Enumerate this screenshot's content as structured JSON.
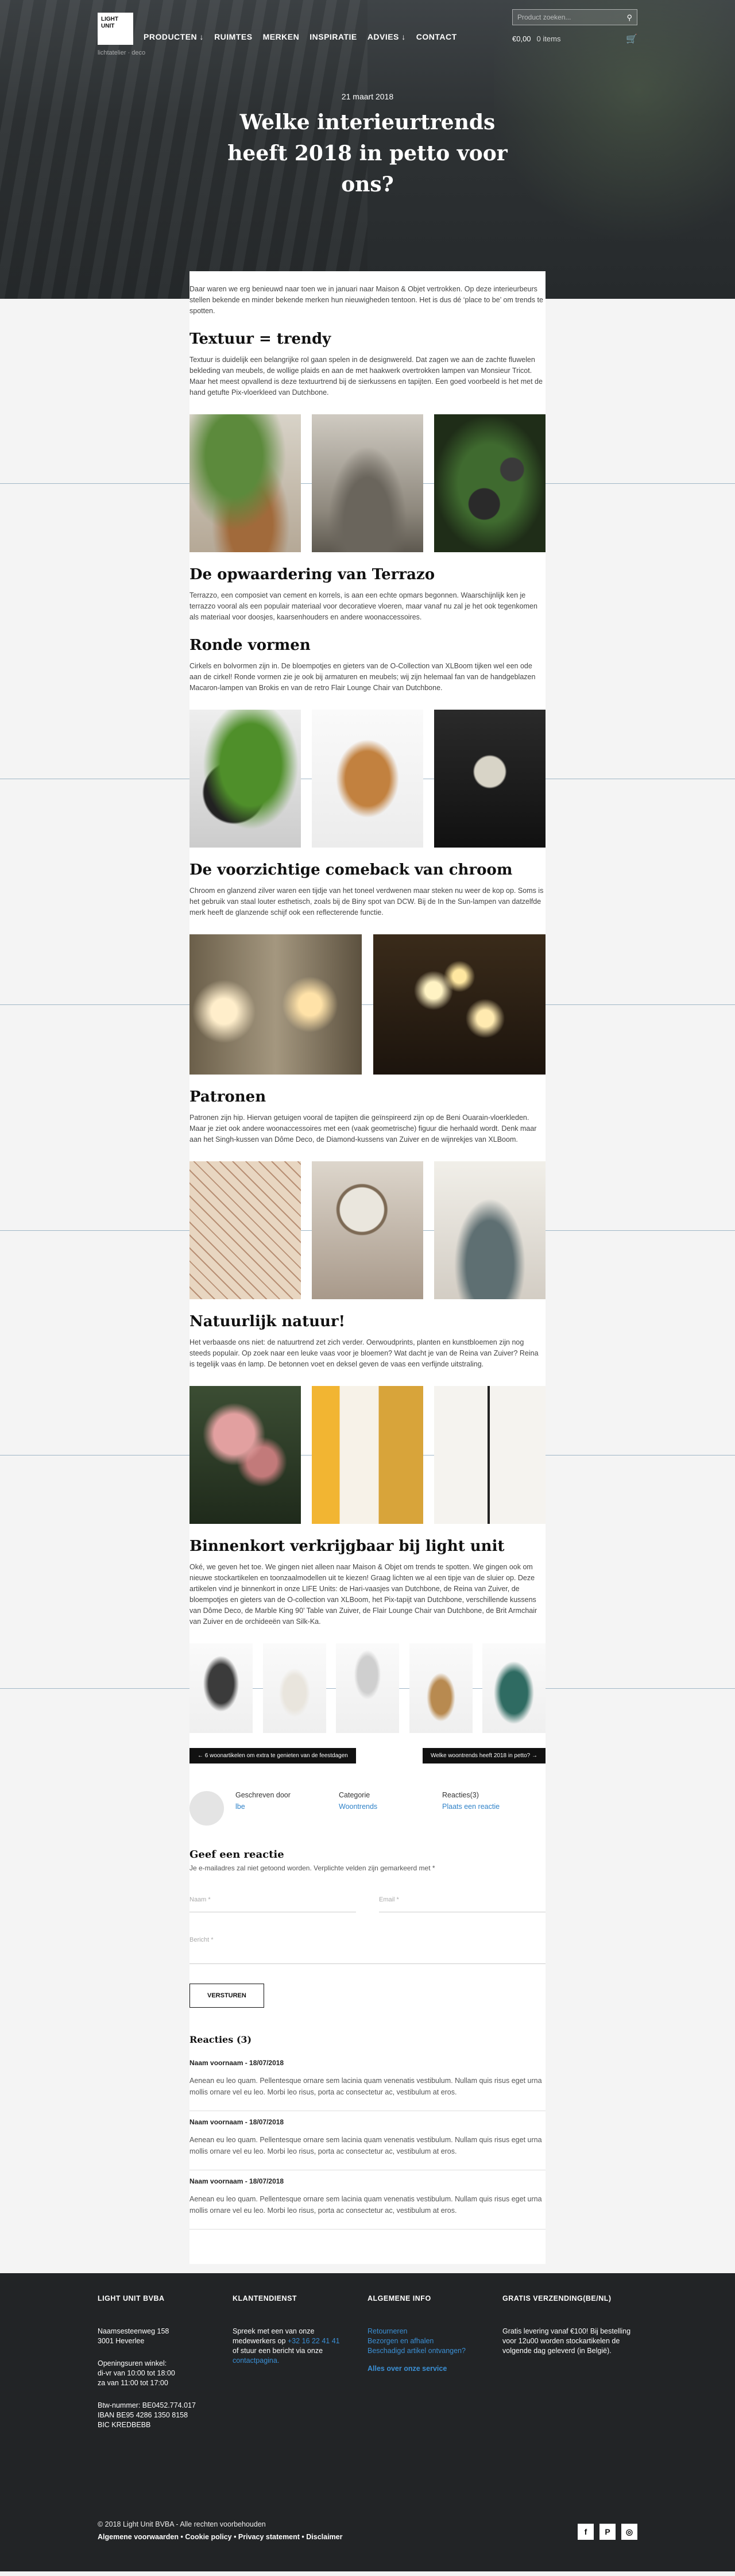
{
  "header": {
    "logo_line1": "LIGHT",
    "logo_line2": "UNIT",
    "nav": [
      "PRODUCTEN ↓",
      "RUIMTES",
      "MERKEN",
      "INSPIRATIE",
      "ADVIES ↓",
      "CONTACT"
    ],
    "sub_logos": "lichtatelier  ·  deco",
    "search_placeholder": "Product zoeken...",
    "cart_total": "€0,00",
    "cart_items": "0 items"
  },
  "hero": {
    "date": "21 maart 2018",
    "title": "Welke interieurtrends heeft 2018 in petto voor ons?"
  },
  "article": {
    "intro": "Daar waren we erg benieuwd naar toen we in januari naar Maison & Objet vertrokken. Op deze interieurbeurs stellen bekende en minder bekende merken hun nieuwigheden tentoon. Het is dus dé ‘place to be’ om trends te spotten.",
    "sections": [
      {
        "title": "Textuur = trendy",
        "text": "Textuur is duidelijk een belangrijke rol gaan spelen in de designwereld. Dat zagen we aan de zachte fluwelen bekleding van meubels, de wollige plaids en aan de met haakwerk overtrokken lampen van Monsieur Tricot.",
        "text2": "Maar het meest opvallend is deze textuurtrend bij de sierkussens en tapijten. Een goed voorbeeld is het met de hand getufte Pix-vloerkleed van Dutchbone."
      },
      {
        "title": "De opwaardering van Terrazo",
        "text": "Terrazzo, een composiet van cement en korrels, is aan een echte opmars begonnen. Waarschijnlijk ken je terrazzo vooral als een populair materiaal voor decoratieve vloeren, maar vanaf nu zal je het ook tegenkomen als materiaal voor doosjes, kaarsenhouders en andere woonaccessoires."
      },
      {
        "title": "Ronde vormen",
        "text": "Cirkels en bolvormen zijn in. De bloempotjes en gieters van de O-Collection van XLBoom tijken wel een ode aan de cirkel! Ronde vormen zie je ook bij armaturen en meubels; wij zijn helemaal fan van de handgeblazen Macaron-lampen van Brokis en van de retro Flair Lounge Chair van Dutchbone."
      },
      {
        "title": "De voorzichtige comeback van chroom",
        "text": "Chroom en glanzend zilver waren een tijdje van het toneel verdwenen maar steken nu weer de kop op. Soms is het gebruik van staal louter esthetisch, zoals bij de Biny spot van DCW. Bij de In the Sun-lampen van datzelfde merk heeft de glanzende schijf ook een reflecterende functie."
      },
      {
        "title": "Patronen",
        "text": "Patronen zijn hip. Hiervan getuigen vooral de tapijten die geïnspireerd zijn op de Beni Ouarain-vloerkleden. Maar je ziet ook andere woonaccessoires met een (vaak geometrische) figuur die herhaald wordt. Denk maar aan het Singh-kussen van Dôme Deco, de Diamond-kussens van Zuiver en de wijnrekjes van XLBoom."
      },
      {
        "title": "Natuurlijk natuur!",
        "text": "Het verbaasde ons niet: de natuurtrend zet zich verder. Oerwoudprints, planten en kunstbloemen zijn nog steeds populair. Op zoek naar een leuke vaas voor je bloemen? Wat dacht je van de Reina van Zuiver? Reina is tegelijk vaas én lamp. De betonnen voet en deksel geven de vaas een verfijnde uitstraling."
      },
      {
        "title": "Binnenkort verkrijgbaar bij light unit",
        "text": "Oké, we geven het toe. We gingen niet alleen naar Maison & Objet om trends te spotten. We gingen ook om nieuwe stockartikelen en toonzaalmodellen uit te kiezen! Graag lichten we al een tipje van de sluier op. Deze artikelen vind je binnenkort in onze LIFE Units: de Hari-vaasjes van Dutchbone, de Reina van Zuiver, de bloempotjes en gieters van de O-collection van XLBoom, het Pix-tapijt van Dutchbone, verschillende kussens van Dôme Deco, de Marble King 90’ Table van Zuiver, de Flair Lounge Chair van Dutchbone, de Brit Armchair van Zuiver en de orchideeën van Silk-Ka."
      }
    ],
    "prev_label": "←  6 woonartikelen om extra te genieten van de feestdagen",
    "next_label": "Welke woontrends heeft 2018 in petto?  →",
    "meta": {
      "author_label": "Geschreven door",
      "author": "lbe",
      "category_label": "Categorie",
      "category": "Woontrends",
      "reactions_label": "Reacties(3)",
      "reactions_link": "Plaats een reactie"
    },
    "reply": {
      "title": "Geef een reactie",
      "note": "Je e-mailadres zal niet getoond worden. Verplichte velden zijn gemarkeerd met *",
      "name_placeholder": "Naam *",
      "email_placeholder": "Email *",
      "message_placeholder": "Bericht *",
      "submit": "VERSTUREN"
    },
    "reactions": {
      "title": "Reacties (3)",
      "items": [
        {
          "name": "Naam voornaam - 18/07/2018",
          "text": "Aenean eu leo quam. Pellentesque ornare sem lacinia quam venenatis vestibulum. Nullam quis risus eget urna mollis ornare vel eu leo. Morbi leo risus, porta ac consectetur ac, vestibulum at eros."
        },
        {
          "name": "Naam voornaam - 18/07/2018",
          "text": "Aenean eu leo quam. Pellentesque ornare sem lacinia quam venenatis vestibulum. Nullam quis risus eget urna mollis ornare vel eu leo. Morbi leo risus, porta ac consectetur ac, vestibulum at eros."
        },
        {
          "name": "Naam voornaam - 18/07/2018",
          "text": "Aenean eu leo quam. Pellentesque ornare sem lacinia quam venenatis vestibulum. Nullam quis risus eget urna mollis ornare vel eu leo. Morbi leo risus, porta ac consectetur ac, vestibulum at eros."
        }
      ]
    }
  },
  "footer": {
    "col1": {
      "title": "LIGHT UNIT BVBA",
      "address1": "Naamsesteenweg 158",
      "address2": "3001 Heverlee",
      "hours_title": "Openingsuren winkel:",
      "hours1": "di-vr van 10:00 tot 18:00",
      "hours2": "za van 11:00 tot 17:00",
      "btw": "Btw-nummer: BE0452.774.017",
      "iban": "IBAN BE95 4286 1350 8158",
      "bic": "BIC KREDBEBB"
    },
    "col2": {
      "title": "KLANTENDIENST",
      "text1": "Spreek met een van onze",
      "text2": "medewerkers op",
      "phone": "+32 16 22 41 41",
      "text3": "of stuur een bericht via onze",
      "link": "contactpagina."
    },
    "col3": {
      "title": "ALGEMENE INFO",
      "links": [
        "Retourneren",
        "Bezorgen en afhalen",
        "Beschadigd artikel ontvangen?"
      ],
      "bold_link": "Alles over onze service"
    },
    "col4": {
      "title": "GRATIS VERZENDING(BE/NL)",
      "text": "Gratis levering vanaf €100! Bij bestelling voor 12u00 worden stockartikelen de volgende dag geleverd (in België)."
    },
    "copyright": "© 2018 Light Unit BVBA - Alle rechten voorbehouden",
    "legal": "Algemene voorwaarden • Cookie policy • Privacy statement • Disclaimer",
    "social": [
      "f",
      "P",
      "◎"
    ]
  }
}
